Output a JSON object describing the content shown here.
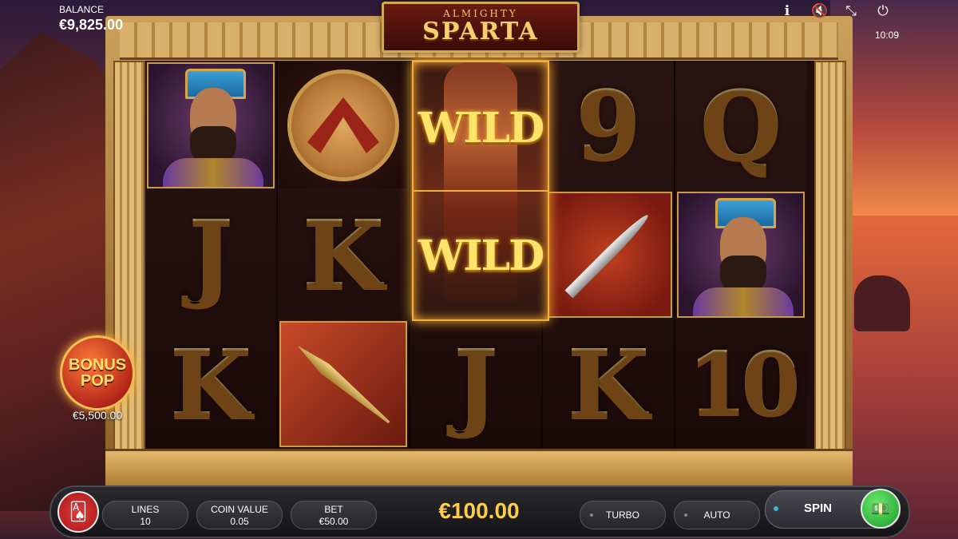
{
  "game": {
    "logo_top": "ALMIGHTY",
    "logo_main": "SPARTA"
  },
  "hud": {
    "balance_label": "BALANCE",
    "balance_value": "€9,825.00",
    "clock": "10:09",
    "icons": [
      "info-icon",
      "sound-muted-icon",
      "fullscreen-icon",
      "power-icon"
    ]
  },
  "bonus": {
    "line1": "BONUS",
    "line2": "POP",
    "amount": "€5,500.00"
  },
  "reels": {
    "reel1": [
      "king",
      "J",
      "K"
    ],
    "reel2": [
      "shield",
      "K",
      "spear"
    ],
    "reel3": [
      "WILD",
      "WILD",
      "J"
    ],
    "reel4": [
      "9",
      "sword",
      "K"
    ],
    "reel5": [
      "Q",
      "king",
      "10"
    ]
  },
  "wild_label": "WILD",
  "controls": {
    "lines_label": "LINES",
    "lines_value": "10",
    "coin_label": "COIN VALUE",
    "coin_value": "0.05",
    "bet_label": "BET",
    "bet_value": "€50.00",
    "total": "€100.00",
    "turbo_label": "TURBO",
    "auto_label": "AUTO",
    "spin_label": "SPIN"
  }
}
